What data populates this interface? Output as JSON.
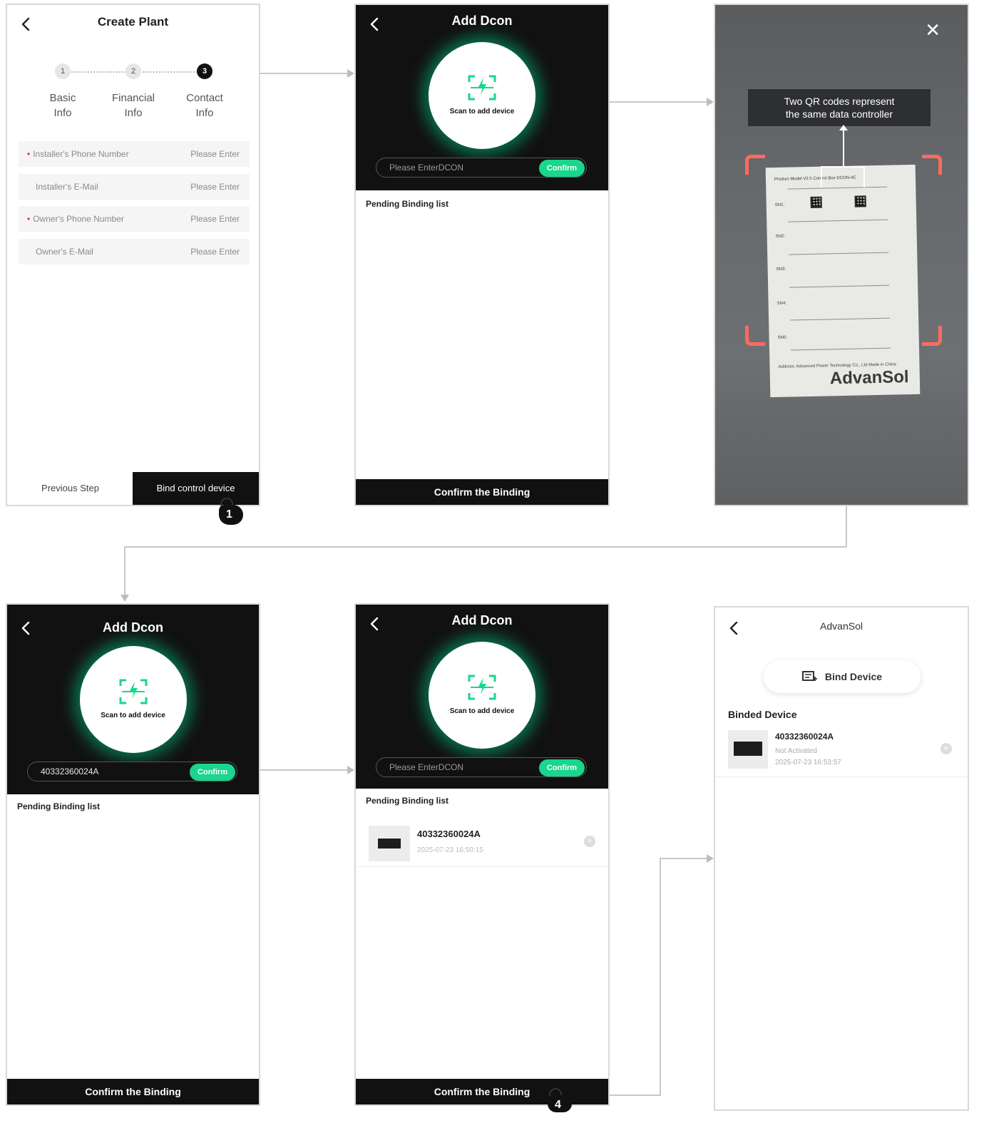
{
  "create_plant": {
    "title": "Create Plant",
    "steps": [
      {
        "num": "1",
        "label": "Basic\nInfo"
      },
      {
        "num": "2",
        "label": "Financial\nInfo"
      },
      {
        "num": "3",
        "label": "Contact\nInfo"
      }
    ],
    "fields": [
      {
        "label": "Installer's Phone Number",
        "required": true,
        "placeholder": "Please Enter"
      },
      {
        "label": "Installer's E-Mail",
        "required": false,
        "placeholder": "Please Enter"
      },
      {
        "label": "Owner's Phone Number",
        "required": true,
        "placeholder": "Please Enter"
      },
      {
        "label": "Owner's E-Mail",
        "required": false,
        "placeholder": "Please Enter"
      }
    ],
    "previous_label": "Previous Step",
    "bind_label": "Bind control device",
    "tap_number": "1"
  },
  "add_dcon_1": {
    "title": "Add Dcon",
    "scan_text": "Scan to add device",
    "input_placeholder": "Please EnterDCON",
    "confirm_label": "Confirm",
    "pending_title": "Pending Binding list",
    "confirm_binding_label": "Confirm the Binding"
  },
  "scanner": {
    "tooltip_line1": "Two QR codes represent",
    "tooltip_line2": "the same data controller",
    "label_model": "Product Model  V2.5 Control Box DCON-4C",
    "label_rows": [
      "SN1:",
      "SN2:",
      "SN3:",
      "SN4:",
      "SN5:"
    ],
    "label_address": "Address: Advanced Power Technology Co., Ltd Made in China",
    "label_logo": "AdvanSol"
  },
  "add_dcon_2": {
    "title": "Add Dcon",
    "scan_text": "Scan to add device",
    "input_value": "40332360024A",
    "confirm_label": "Confirm",
    "pending_title": "Pending Binding list",
    "confirm_binding_label": "Confirm the Binding"
  },
  "add_dcon_3": {
    "title": "Add Dcon",
    "scan_text": "Scan to add device",
    "input_placeholder": "Please EnterDCON",
    "confirm_label": "Confirm",
    "pending_title": "Pending Binding list",
    "pending_item": {
      "sn": "40332360024A",
      "time": "2025-07-23 16:50:15"
    },
    "confirm_binding_label": "Confirm the Binding",
    "tap_number": "4"
  },
  "advansol": {
    "title": "AdvanSol",
    "bind_device_label": "Bind Device",
    "binded_title": "Binded Device",
    "device": {
      "sn": "40332360024A",
      "status": "Not Activated",
      "time": "2025-07-23 16:53:57"
    }
  },
  "colors": {
    "accent": "#19d68c",
    "dark": "#111111",
    "required": "#d9342b",
    "scan_frame": "#ff6a5f"
  }
}
